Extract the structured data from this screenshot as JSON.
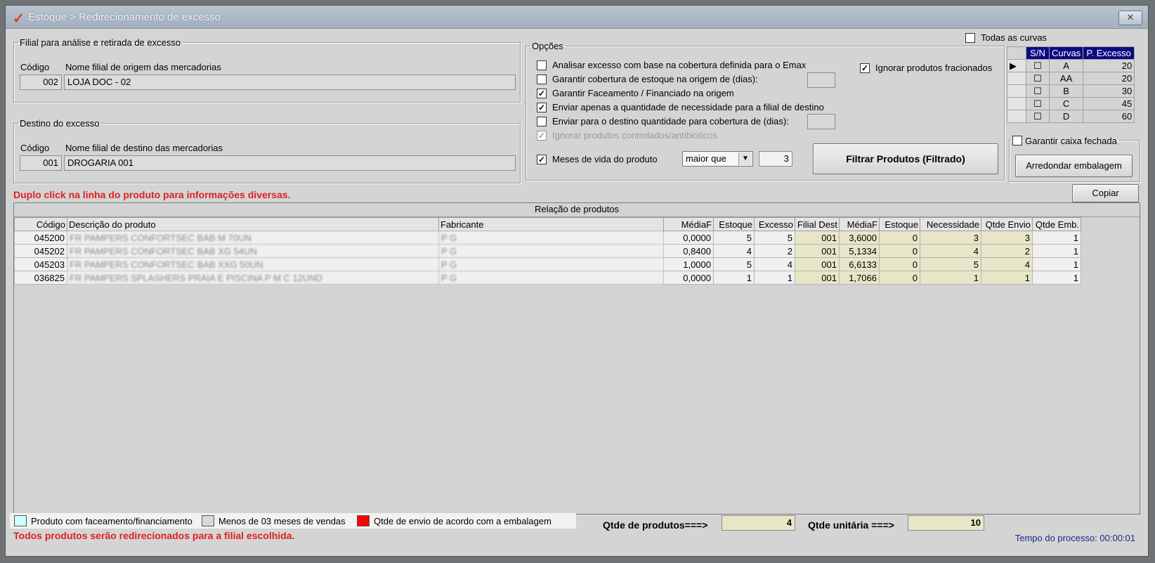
{
  "window": {
    "title": "Estoque > Redirecionamento de excesso",
    "close_label": "✕"
  },
  "origem": {
    "legend": "Filial para análise e retirada de excesso",
    "codigo_label": "Código",
    "nome_label": "Nome filial de origem das mercadorias",
    "codigo": "002",
    "nome": "LOJA DOC - 02"
  },
  "destino": {
    "legend": "Destino do excesso",
    "codigo_label": "Código",
    "nome_label": "Nome filial de destino das mercadorias",
    "codigo": "001",
    "nome": "DROGARIA 001"
  },
  "opcoes": {
    "legend": "Opções",
    "items": [
      {
        "label": "Analisar excesso com base na cobertura definida para o Emax",
        "checked": false
      },
      {
        "label": "Garantir cobertura de estoque na origem de (dias):",
        "checked": false
      },
      {
        "label": "Garantir Faceamento / Financiado na origem",
        "checked": true
      },
      {
        "label": "Enviar apenas a quantidade de necessidade para a filial de destino",
        "checked": true
      },
      {
        "label": "Enviar para o destino quantidade para cobertura de (dias):",
        "checked": false
      },
      {
        "label": "Ignorar produtos controlados/antibióticos",
        "checked": true
      }
    ],
    "ignorar_fracionados": "Ignorar produtos fracionados",
    "meses_label": "Meses de vida do produto",
    "meses_op": "maior que",
    "meses_valor": "3",
    "filtrar_button": "Filtrar Produtos (Filtrado)"
  },
  "curvas": {
    "todas_label": "Todas as curvas",
    "headers": [
      "S/N",
      "Curvas",
      "P. Excesso"
    ],
    "rows": [
      {
        "curva": "A",
        "pct": "20"
      },
      {
        "curva": "AA",
        "pct": "20"
      },
      {
        "curva": "B",
        "pct": "30"
      },
      {
        "curva": "C",
        "pct": "45"
      },
      {
        "curva": "D",
        "pct": "60"
      }
    ]
  },
  "embalagem": {
    "legend": "Garantir caixa fechada",
    "button": "Arredondar embalagem"
  },
  "hint": "Duplo click na linha do produto para informações diversas.",
  "copiar_button": "Copiar",
  "grid": {
    "caption": "Relação de produtos",
    "headers": [
      "Código",
      "Descrição do produto",
      "Fabricante",
      "MédiaF",
      "Estoque",
      "Excesso",
      "Filial Dest",
      "MédiaF",
      "Estoque",
      "Necessidade",
      "Qtde Envio",
      "Qtde Emb."
    ],
    "rows": [
      [
        "045200",
        "FR PAMPERS CONFORTSEC BAB M 70UN",
        "P G",
        "0,0000",
        "5",
        "5",
        "001",
        "3,6000",
        "0",
        "3",
        "3",
        "1"
      ],
      [
        "045202",
        "FR PAMPERS CONFORTSEC BAB XG 54UN",
        "P G",
        "0,8400",
        "4",
        "2",
        "001",
        "5,1334",
        "0",
        "4",
        "2",
        "1"
      ],
      [
        "045203",
        "FR PAMPERS CONFORTSEC BAB XXG 50UN",
        "P G",
        "1,0000",
        "5",
        "4",
        "001",
        "6,6133",
        "0",
        "5",
        "4",
        "1"
      ],
      [
        "036825",
        "FR PAMPERS SPLASHERS PRAIA E PISCINA P M C 12UND",
        "P G",
        "0,0000",
        "1",
        "1",
        "001",
        "1,7066",
        "0",
        "1",
        "1",
        "1"
      ]
    ]
  },
  "legend": [
    {
      "label": "Produto com faceamento/financiamento",
      "color": "#cfffff"
    },
    {
      "label": "Menos de 03 meses de vendas",
      "color": "#d8d8d8"
    },
    {
      "label": "Qtde de envio de acordo com a embalagem",
      "color": "#ff0000"
    }
  ],
  "footer_msg": "Todos produtos serão redirecionados para a filial escolhida.",
  "totais": {
    "produtos_label": "Qtde de produtos===>",
    "produtos": "4",
    "unitaria_label": "Qtde unitária ===>",
    "unitaria": "10"
  },
  "tempo": "Tempo do processo: 00:00:01"
}
